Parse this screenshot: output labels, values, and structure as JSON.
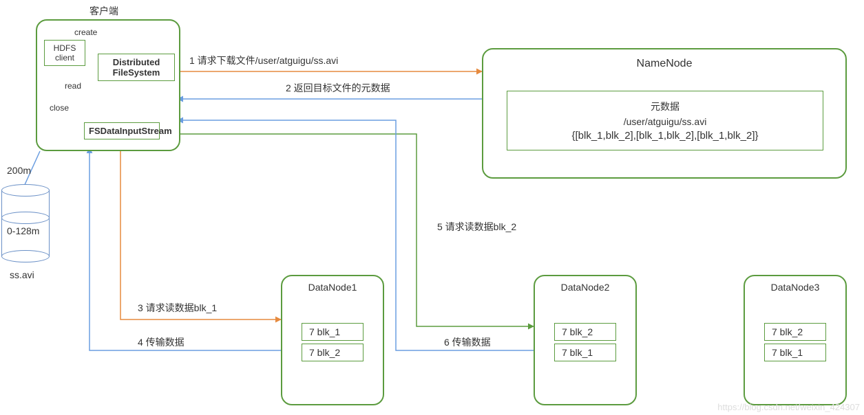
{
  "client": {
    "title": "客户端",
    "hdfs_client": "HDFS client",
    "dfs": "Distributed FileSystem",
    "stream": "FSDataInputStream",
    "create": "create",
    "read": "read",
    "close": "close"
  },
  "cylinder": {
    "top_label": "200m",
    "mid_label": "0-128m",
    "file_label": "ss.avi"
  },
  "namenode": {
    "title": "NameNode",
    "meta_title": "元数据",
    "path": "/user/atguigu/ss.avi",
    "blocks": "{[blk_1,blk_2],[blk_1,blk_2],[blk_1,blk_2]}"
  },
  "steps": {
    "s1": "1 请求下载文件/user/atguigu/ss.avi",
    "s2": "2 返回目标文件的元数据",
    "s3": "3 请求读数据blk_1",
    "s4": "4 传输数据",
    "s5": "5 请求读数据blk_2",
    "s6": "6 传输数据"
  },
  "datanodes": {
    "d1": {
      "title": "DataNode1",
      "b1": "7 blk_1",
      "b2": "7 blk_2"
    },
    "d2": {
      "title": "DataNode2",
      "b1": "7 blk_2",
      "b2": "7 blk_1"
    },
    "d3": {
      "title": "DataNode3",
      "b1": "7 blk_2",
      "b2": "7 blk_1"
    }
  },
  "watermark": "https://blog.csdn.net/weixin_424307"
}
